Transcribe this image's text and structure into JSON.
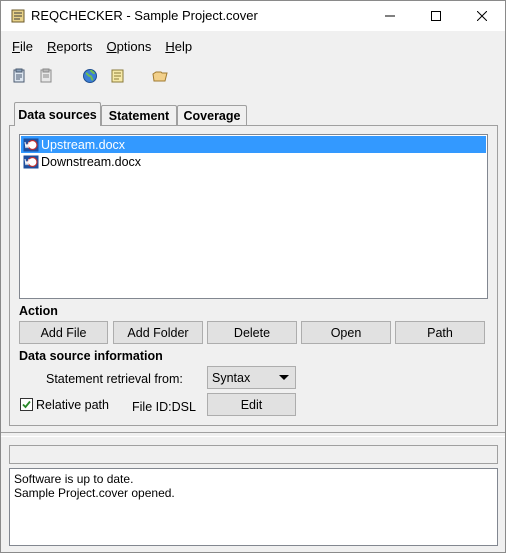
{
  "window": {
    "title": "REQCHECKER - Sample Project.cover"
  },
  "menu": [
    {
      "label_u": "F",
      "label_rest": "ile"
    },
    {
      "label_u": "R",
      "label_rest": "eports"
    },
    {
      "label_u": "O",
      "label_rest": "ptions"
    },
    {
      "label_u": "H",
      "label_rest": "elp"
    }
  ],
  "toolbar": {
    "icons": [
      "new-project-icon",
      "open-project-icon",
      "globe-icon",
      "notebook-icon",
      "folder-icon"
    ]
  },
  "tabs": [
    "Data sources",
    "Statement",
    "Coverage"
  ],
  "datasources": {
    "files": [
      "Upstream.docx",
      "Downstream.docx"
    ],
    "selected_index": 0
  },
  "action": {
    "heading": "Action",
    "buttons": [
      "Add File",
      "Add Folder",
      "Delete",
      "Open",
      "Path"
    ]
  },
  "info": {
    "heading": "Data source information",
    "retrieval_label": "Statement retrieval from:",
    "retrieval_value": "Syntax",
    "relative_path_label": "Relative path",
    "relative_path_checked": true,
    "file_id_label": "File ID:DSL",
    "edit_button": "Edit"
  },
  "status_bar": "",
  "log": [
    "Software is up to date.",
    "Sample Project.cover opened."
  ],
  "colors": {
    "selection": "#3399ff",
    "window_bg": "#f0f0f0"
  }
}
